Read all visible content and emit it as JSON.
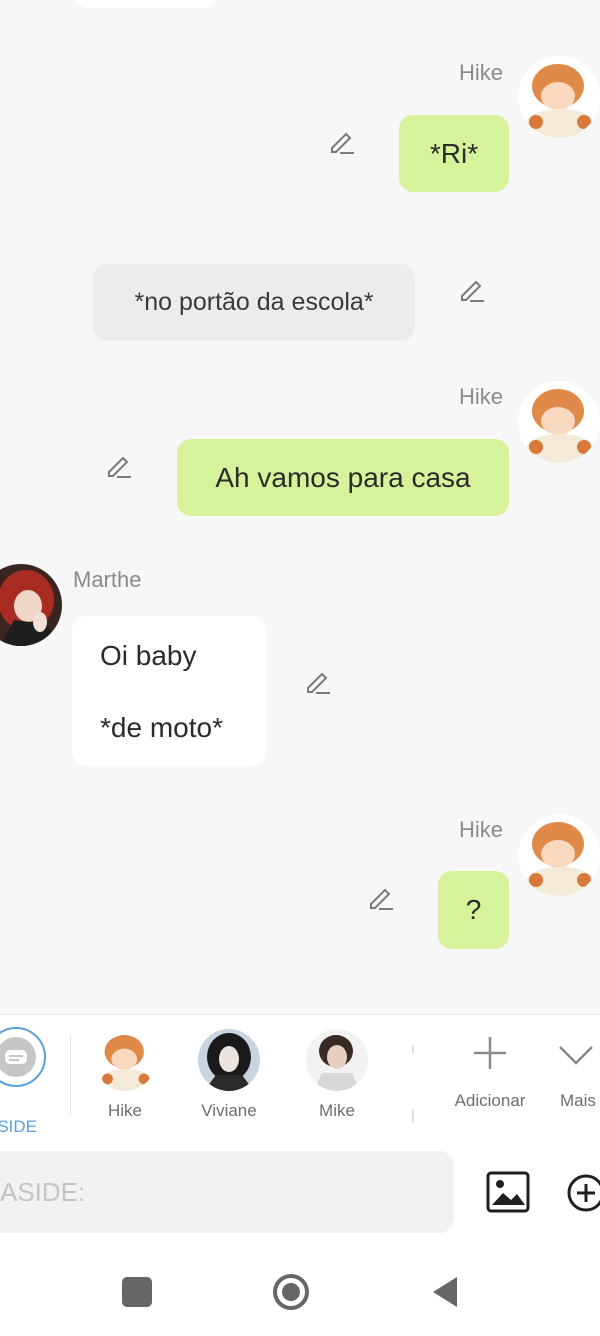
{
  "messages": [
    {
      "sender": "Hike",
      "text": "*Ri*"
    },
    {
      "sender": "",
      "text": "*no portão da escola*"
    },
    {
      "sender": "Hike",
      "text": "Ah vamos para casa"
    },
    {
      "sender": "Marthe",
      "lines": [
        "Oi baby",
        "*de moto*"
      ]
    },
    {
      "sender": "Hike",
      "text": "?"
    }
  ],
  "character_bar": {
    "aside_label": "ASIDE",
    "characters": [
      "Hike",
      "Viviane",
      "Mike"
    ],
    "add_label": "Adicionar",
    "more_label": "Mais"
  },
  "composer": {
    "placeholder": "ASIDE:"
  },
  "colors": {
    "user_bubble": "#d6f29a",
    "narration_bubble": "#ececec",
    "bot_bubble": "#ffffff",
    "aside_accent": "#5aa0e0"
  },
  "icons": [
    "edit-icon",
    "plus-icon",
    "chevron-down-icon",
    "image-icon",
    "add-circle-icon",
    "square-nav-icon",
    "home-nav-icon",
    "back-nav-icon"
  ]
}
